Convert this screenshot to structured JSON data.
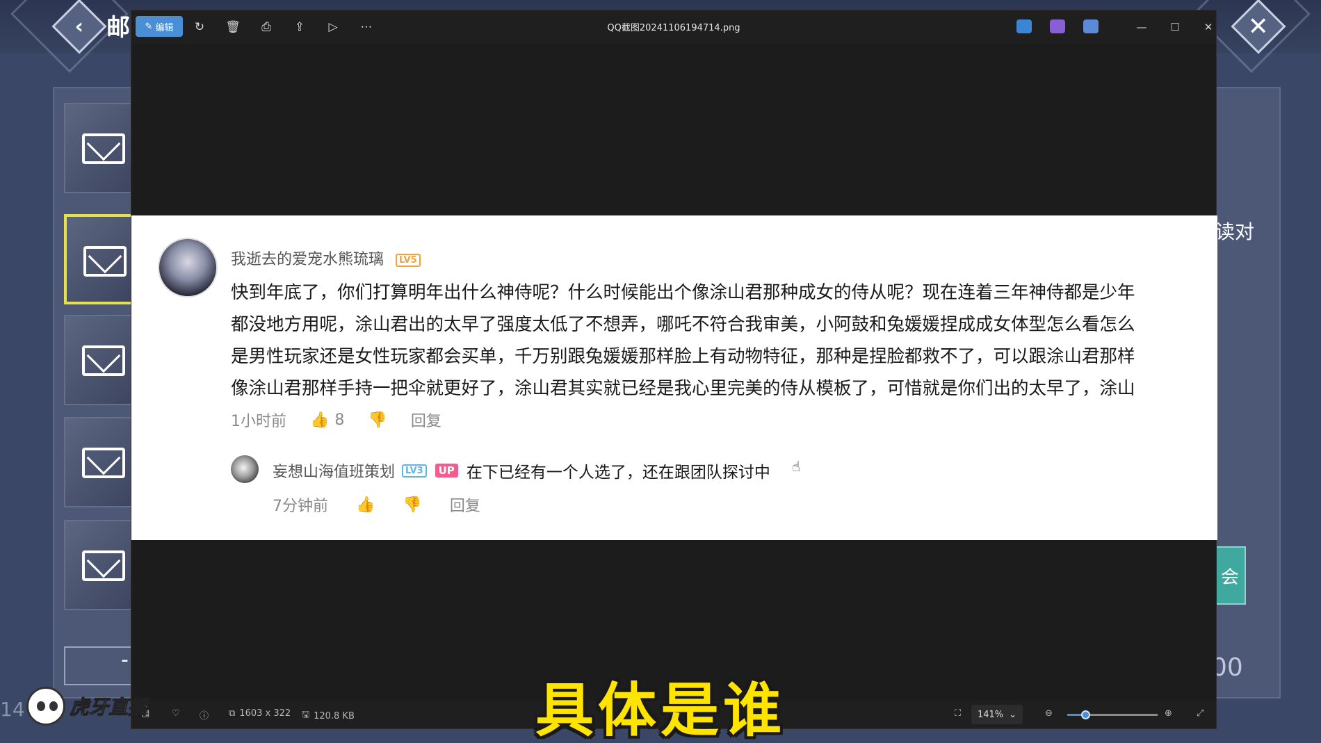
{
  "game": {
    "title": "邮",
    "back_icon": "chevron-left-icon",
    "close_icon": "close-x-icon",
    "right_side_text": "读对",
    "teal_button_label": "会",
    "bottom_number": "00",
    "bottom_left_label": "-",
    "left_number": "14"
  },
  "viewer": {
    "edit_label": "编辑",
    "filename": "QQ截图20241106194714.png",
    "toolbar_icons": [
      "rotate-icon",
      "trash-icon",
      "print-icon",
      "share-icon",
      "slideshow-icon",
      "more-icon"
    ],
    "status": {
      "dimensions": "1603 x 322",
      "file_size": "120.8 KB",
      "zoom": "141%",
      "zoom_level": 0.2
    }
  },
  "comment": {
    "username": "我逝去的爱宠水熊琉璃",
    "level": "LV5",
    "lines": [
      "快到年底了，你们打算明年出什么神侍呢？什么时候能出个像涂山君那种成女的侍从呢？现在连着三年神侍都是少年",
      "都没地方用呢，涂山君出的太早了强度太低了不想弄，哪吒不符合我审美，小阿鼓和兔媛媛捏成成女体型怎么看怎么",
      "是男性玩家还是女性玩家都会买单，千万别跟兔媛媛那样脸上有动物特征，那种是捏脸都救不了，可以跟涂山君那样",
      "像涂山君那样手持一把伞就更好了，涂山君其实就已经是我心里完美的侍从模板了，可惜就是你们出的太早了，涂山"
    ],
    "time": "1小时前",
    "likes": "8",
    "reply_label": "回复"
  },
  "reply": {
    "username": "妄想山海值班策划",
    "level": "LV3",
    "up_tag": "UP",
    "text": "在下已经有一个人选了，还在跟团队探讨中",
    "time": "7分钟前",
    "reply_label": "回复"
  },
  "overlay": {
    "brand": "虎牙直播",
    "subtitle": "具体是谁"
  }
}
